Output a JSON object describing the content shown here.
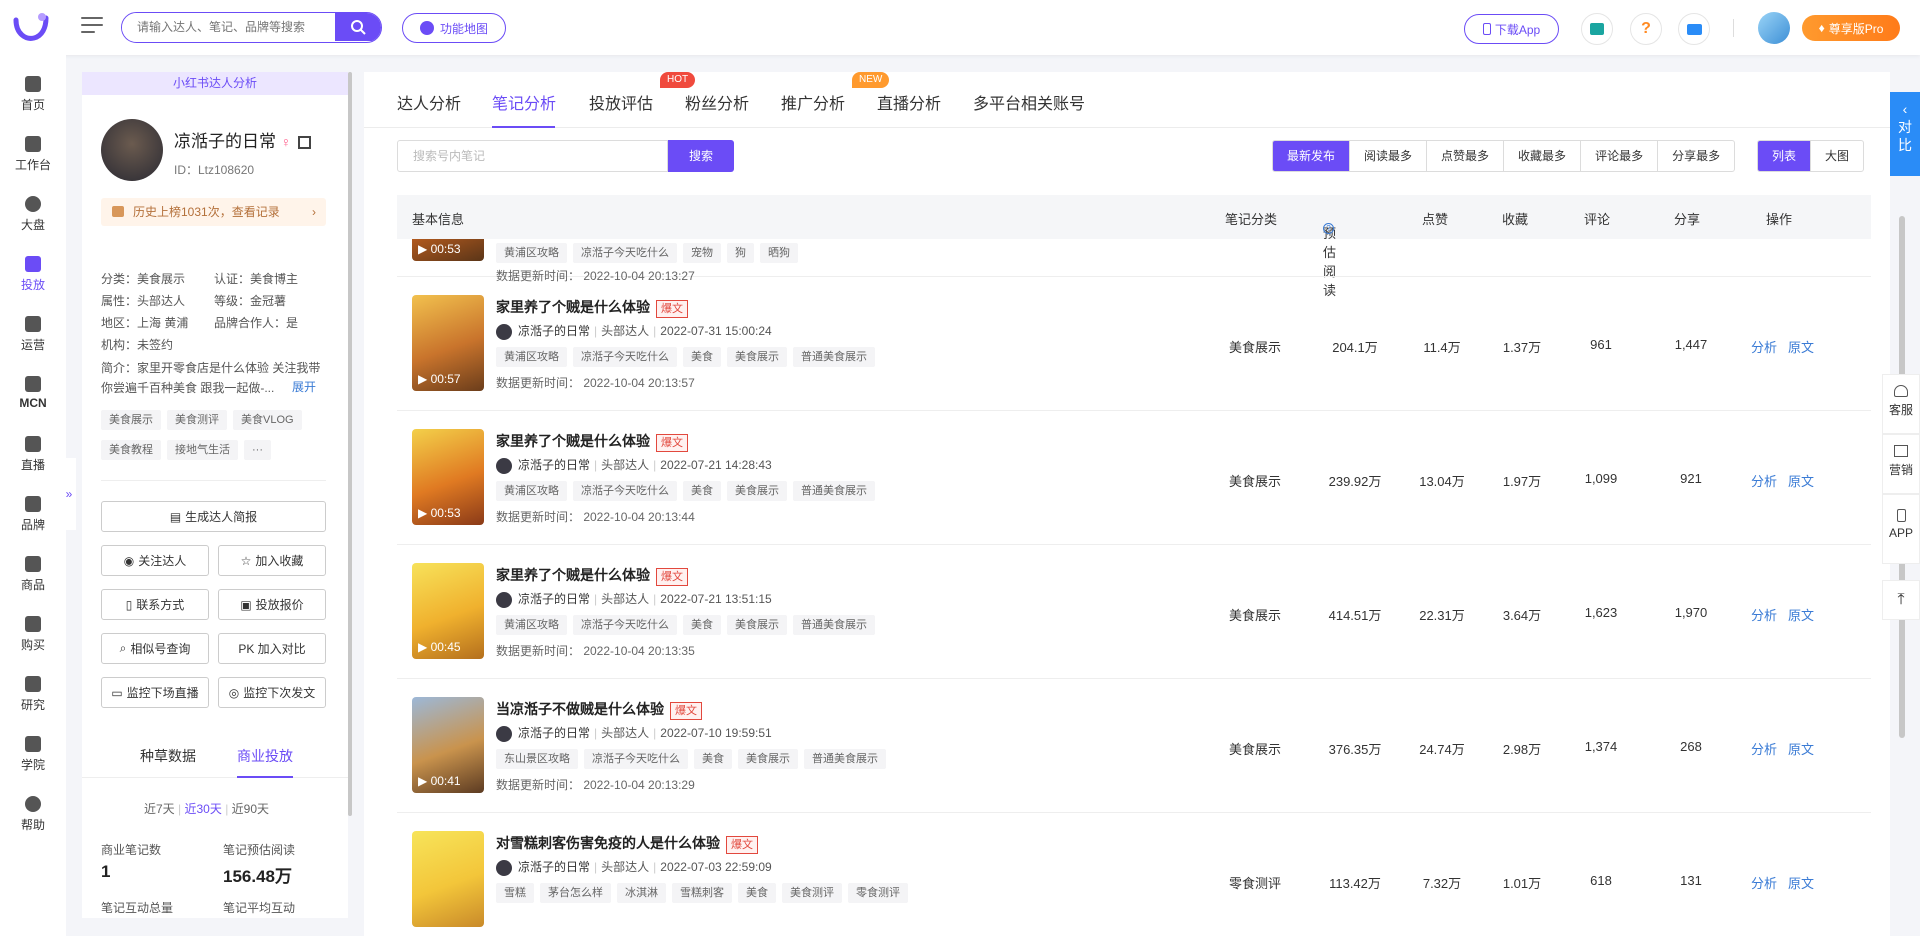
{
  "header": {
    "search_placeholder": "请输入达人、笔记、品牌等搜索",
    "func_map": "功能地图",
    "download_app": "下载App",
    "pro_badge": "尊享版Pro"
  },
  "nav": [
    {
      "label": "首页",
      "icon": "home-icon"
    },
    {
      "label": "工作台",
      "icon": "workbench-icon"
    },
    {
      "label": "大盘",
      "icon": "pie-chart-icon"
    },
    {
      "label": "投放",
      "icon": "folder-icon"
    },
    {
      "label": "运营",
      "icon": "chat-icon"
    },
    {
      "label": "MCN",
      "icon": "building-icon"
    },
    {
      "label": "直播",
      "icon": "video-icon"
    },
    {
      "label": "品牌",
      "icon": "brand-icon"
    },
    {
      "label": "商品",
      "icon": "bag-icon"
    },
    {
      "label": "购买",
      "icon": "cart-icon"
    },
    {
      "label": "研究",
      "icon": "flask-icon"
    },
    {
      "label": "学院",
      "icon": "graduation-icon"
    },
    {
      "label": "帮助",
      "icon": "help-icon"
    }
  ],
  "profile": {
    "section_title": "小红书达人分析",
    "name": "凉湉子的日常",
    "id": "ID：Ltz108620",
    "history": "历史上榜1031次，查看记录",
    "meta": {
      "category": "分类：美食展示",
      "certified": "认证：美食博主",
      "attribute": "属性：头部达人",
      "level": "等级：金冠薯",
      "region": "地区：上海 黄浦",
      "brand_partner": "品牌合作人：是",
      "agency": "机构：未签约",
      "intro": "简介：家里开零食店是什么体验 关注我带你尝遍千百种美食 跟我一起做-...",
      "expand": "展开"
    },
    "tags": [
      "美食展示",
      "美食测评",
      "美食VLOG",
      "美食教程",
      "接地气生活",
      "···"
    ],
    "buttons": {
      "generate": "生成达人简报",
      "follow": "关注达人",
      "favorite": "加入收藏",
      "contact": "联系方式",
      "quote": "投放报价",
      "similar": "相似号查询",
      "compare": "PK 加入对比",
      "monitor_live": "监控下场直播",
      "monitor_post": "监控下次发文"
    },
    "data_tabs": [
      "种草数据",
      "商业投放"
    ],
    "period": [
      "近7天",
      "近30天",
      "近90天"
    ],
    "stats": {
      "biz_notes_label": "商业笔记数",
      "biz_notes_value": "1",
      "est_read_label": "笔记预估阅读",
      "est_read_value": "156.48万",
      "interaction_label": "笔记互动总量",
      "avg_interaction_label": "笔记平均互动"
    }
  },
  "tabs": [
    {
      "label": "达人分析"
    },
    {
      "label": "笔记分析"
    },
    {
      "label": "投放评估"
    },
    {
      "label": "粉丝分析",
      "badge": "HOT"
    },
    {
      "label": "推广分析"
    },
    {
      "label": "直播分析",
      "badge": "NEW"
    },
    {
      "label": "多平台相关账号"
    }
  ],
  "notes_search": {
    "placeholder": "搜索号内笔记",
    "button": "搜索"
  },
  "sort_options": [
    "最新发布",
    "阅读最多",
    "点赞最多",
    "收藏最多",
    "评论最多",
    "分享最多"
  ],
  "view_options": [
    "列表",
    "大图"
  ],
  "table_headers": [
    "基本信息",
    "笔记分类",
    "预估阅读",
    "点赞",
    "收藏",
    "评论",
    "分享",
    "操作"
  ],
  "partial_row": {
    "duration": "00:53",
    "tags": [
      "黄浦区攻略",
      "凉湉子今天吃什么",
      "宠物",
      "狗",
      "晒狗"
    ],
    "updated": "数据更新时间：  2022-10-04 20:13:27"
  },
  "rows": [
    {
      "title": "家里养了个贼是什么体验",
      "hot": "爆文",
      "author": "凉湉子的日常",
      "author_type": "头部达人",
      "date": "2022-07-31 15:00:24",
      "tags": [
        "黄浦区攻略",
        "凉湉子今天吃什么",
        "美食",
        "美食展示",
        "普通美食展示"
      ],
      "updated": "数据更新时间：  2022-10-04 20:13:57",
      "duration": "00:57",
      "category": "美食展示",
      "reads": "204.1万",
      "likes": "11.4万",
      "favorites": "1.37万",
      "comments": "961",
      "shares": "1,447"
    },
    {
      "title": "家里养了个贼是什么体验",
      "hot": "爆文",
      "author": "凉湉子的日常",
      "author_type": "头部达人",
      "date": "2022-07-21 14:28:43",
      "tags": [
        "黄浦区攻略",
        "凉湉子今天吃什么",
        "美食",
        "美食展示",
        "普通美食展示"
      ],
      "updated": "数据更新时间：  2022-10-04 20:13:44",
      "duration": "00:53",
      "category": "美食展示",
      "reads": "239.92万",
      "likes": "13.04万",
      "favorites": "1.97万",
      "comments": "1,099",
      "shares": "921"
    },
    {
      "title": "家里养了个贼是什么体验",
      "hot": "爆文",
      "author": "凉湉子的日常",
      "author_type": "头部达人",
      "date": "2022-07-21 13:51:15",
      "tags": [
        "黄浦区攻略",
        "凉湉子今天吃什么",
        "美食",
        "美食展示",
        "普通美食展示"
      ],
      "updated": "数据更新时间：  2022-10-04 20:13:35",
      "duration": "00:45",
      "category": "美食展示",
      "reads": "414.51万",
      "likes": "22.31万",
      "favorites": "3.64万",
      "comments": "1,623",
      "shares": "1,970"
    },
    {
      "title": "当凉湉子不做贼是什么体验",
      "hot": "爆文",
      "author": "凉湉子的日常",
      "author_type": "头部达人",
      "date": "2022-07-10 19:59:51",
      "tags": [
        "东山景区攻略",
        "凉湉子今天吃什么",
        "美食",
        "美食展示",
        "普通美食展示"
      ],
      "updated": "数据更新时间：  2022-10-04 20:13:29",
      "duration": "00:41",
      "category": "美食展示",
      "reads": "376.35万",
      "likes": "24.74万",
      "favorites": "2.98万",
      "comments": "1,374",
      "shares": "268"
    },
    {
      "title": "对雪糕刺客伤害免疫的人是什么体验",
      "hot": "爆文",
      "author": "凉湉子的日常",
      "author_type": "头部达人",
      "date": "2022-07-03 22:59:09",
      "tags": [
        "雪糕",
        "茅台怎么样",
        "冰淇淋",
        "雪糕刺客",
        "美食",
        "美食测评",
        "零食测评"
      ],
      "updated": "",
      "duration": "",
      "category": "零食测评",
      "reads": "113.42万",
      "likes": "7.32万",
      "favorites": "1.01万",
      "comments": "618",
      "shares": "131"
    }
  ],
  "ops": {
    "analyze": "分析",
    "origin": "原文"
  },
  "right": {
    "compare": "对比",
    "service": "客服",
    "marketing": "营销",
    "app": "APP"
  },
  "colors": {
    "accent": "#6b4cf6",
    "link": "#3a7bd5",
    "hot": "#e2483d",
    "pro": "#ff8a22"
  }
}
